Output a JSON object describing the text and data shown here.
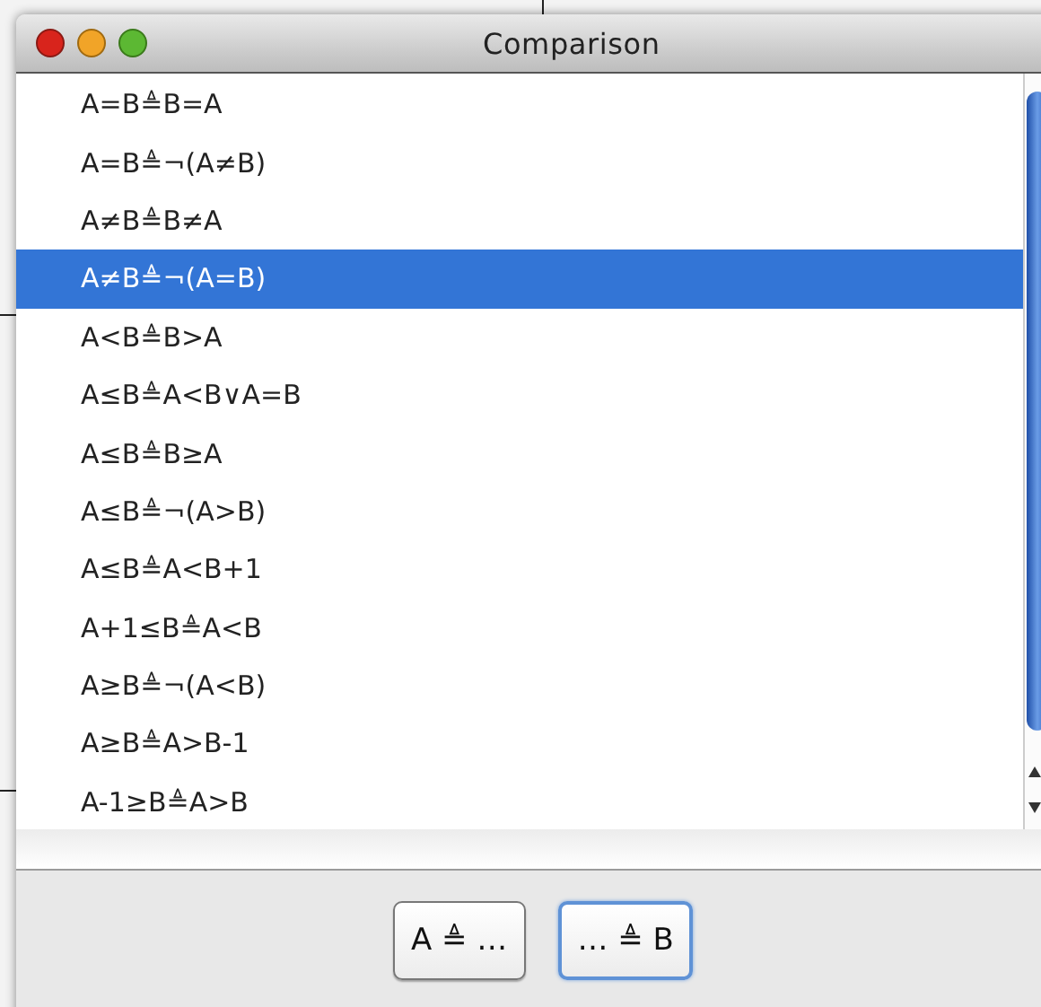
{
  "window": {
    "title": "Comparison"
  },
  "list": {
    "items": [
      {
        "label": "A=B≜B=A",
        "selected": false
      },
      {
        "label": "A=B≜¬(A≠B)",
        "selected": false
      },
      {
        "label": "A≠B≜B≠A",
        "selected": false
      },
      {
        "label": "A≠B≜¬(A=B)",
        "selected": true
      },
      {
        "label": "A<B≜B>A",
        "selected": false
      },
      {
        "label": "A≤B≜A<B∨A=B",
        "selected": false
      },
      {
        "label": "A≤B≜B≥A",
        "selected": false
      },
      {
        "label": "A≤B≜¬(A>B)",
        "selected": false
      },
      {
        "label": "A≤B≜A<B+1",
        "selected": false
      },
      {
        "label": "A+1≤B≜A<B",
        "selected": false
      },
      {
        "label": "A≥B≜¬(A<B)",
        "selected": false
      },
      {
        "label": "A≥B≜A>B-1",
        "selected": false
      },
      {
        "label": "A-1≥B≜A>B",
        "selected": false
      }
    ]
  },
  "buttons": [
    {
      "label": "A ≜ …",
      "default": false
    },
    {
      "label": "… ≜ B",
      "default": true
    }
  ]
}
